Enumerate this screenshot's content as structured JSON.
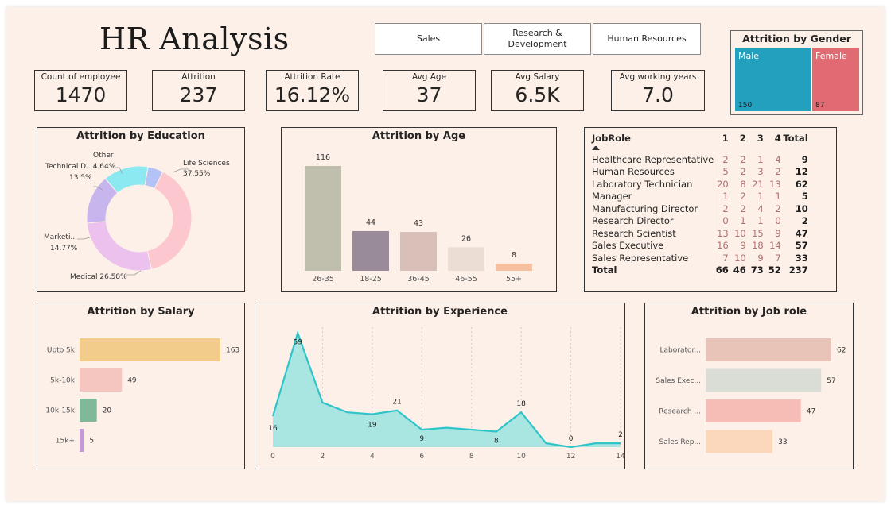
{
  "title": "HR Analysis",
  "slicer": [
    "Sales",
    "Research & Development",
    "Human Resources"
  ],
  "kpis": [
    {
      "label": "Count of employee",
      "value": "1470"
    },
    {
      "label": "Attrition",
      "value": "237"
    },
    {
      "label": "Attrition Rate",
      "value": "16.12%"
    },
    {
      "label": "Avg Age",
      "value": "37"
    },
    {
      "label": "Avg Salary",
      "value": "6.5K"
    },
    {
      "label": "Avg working years",
      "value": "7.0"
    }
  ],
  "gender": {
    "title": "Attrition by Gender",
    "male_label": "Male",
    "male_value": "150",
    "female_label": "Female",
    "female_value": "87",
    "colors": {
      "male": "#22a0bd",
      "female": "#e06b73"
    }
  },
  "chart_data": [
    {
      "type": "donut",
      "title": "Attrition by Education",
      "categories": [
        "Life Sciences",
        "Medical",
        "Marketi...",
        "Technical D...",
        "Other"
      ],
      "values": [
        37.55,
        26.58,
        14.77,
        13.5,
        4.64
      ],
      "labels": [
        "Life Sciences\n37.55%",
        "Medical 26.58%",
        "Marketi...\n14.77%",
        "Technical D...4.64%\n13.5%",
        "Other"
      ],
      "colors": [
        "#fdc7d0",
        "#ecc1ed",
        "#c6b6ed",
        "#8ce9f2",
        "#b4c3f5"
      ]
    },
    {
      "type": "bar",
      "title": "Attrition by Age",
      "categories": [
        "26-35",
        "18-25",
        "36-45",
        "46-55",
        "55+"
      ],
      "values": [
        116,
        44,
        43,
        26,
        8
      ],
      "colors": [
        "#c0bfad",
        "#9a8b9a",
        "#d8c0b8",
        "#ecddd4",
        "#f5bfa0"
      ]
    },
    {
      "type": "table",
      "title": "JobRole",
      "columns": [
        "JobRole",
        "1",
        "2",
        "3",
        "4",
        "Total"
      ],
      "rows": [
        [
          "Healthcare Representative",
          "2",
          "2",
          "1",
          "4",
          "9"
        ],
        [
          "Human Resources",
          "5",
          "2",
          "3",
          "2",
          "12"
        ],
        [
          "Laboratory Technician",
          "20",
          "8",
          "21",
          "13",
          "62"
        ],
        [
          "Manager",
          "1",
          "2",
          "1",
          "1",
          "5"
        ],
        [
          "Manufacturing Director",
          "2",
          "2",
          "4",
          "2",
          "10"
        ],
        [
          "Research Director",
          "0",
          "1",
          "1",
          "0",
          "2"
        ],
        [
          "Research Scientist",
          "13",
          "10",
          "15",
          "9",
          "47"
        ],
        [
          "Sales Executive",
          "16",
          "9",
          "18",
          "14",
          "57"
        ],
        [
          "Sales Representative",
          "7",
          "10",
          "9",
          "7",
          "33"
        ]
      ],
      "total": [
        "Total",
        "66",
        "46",
        "73",
        "52",
        "237"
      ]
    },
    {
      "type": "hbar",
      "title": "Attrition by Salary",
      "categories": [
        "Upto 5k",
        "5k-10k",
        "10k-15k",
        "15k+"
      ],
      "values": [
        163,
        49,
        20,
        5
      ],
      "colors": [
        "#f2cc8b",
        "#f5c5c0",
        "#7fb89a",
        "#c39ad1"
      ]
    },
    {
      "type": "area",
      "title": "Attrition by Experience",
      "x": [
        0,
        1,
        2,
        3,
        4,
        5,
        6,
        7,
        8,
        9,
        10,
        11,
        12,
        13,
        14
      ],
      "y": [
        16,
        59,
        23,
        18,
        17,
        19,
        9,
        10,
        9,
        8,
        18,
        2,
        0,
        2,
        2
      ],
      "labels": [
        {
          "i": 0,
          "t": "16"
        },
        {
          "i": 1,
          "t": "59"
        },
        {
          "i": 4,
          "t": "19"
        },
        {
          "i": 5,
          "t": "21"
        },
        {
          "i": 6,
          "t": "9"
        },
        {
          "i": 9,
          "t": "8"
        },
        {
          "i": 10,
          "t": "18"
        },
        {
          "i": 12,
          "t": "0"
        },
        {
          "i": 14,
          "t": "2"
        }
      ],
      "xticks": [
        "0",
        "2",
        "4",
        "6",
        "8",
        "10",
        "12",
        "14"
      ],
      "color": "#2ec4c9",
      "fill": "#a9e6e2"
    },
    {
      "type": "hbar",
      "title": "Attrition by Job role",
      "categories": [
        "Laborator...",
        "Sales Exec...",
        "Research ...",
        "Sales Rep..."
      ],
      "values": [
        62,
        57,
        47,
        33
      ],
      "colors": [
        "#e8c4b8",
        "#d9ddd5",
        "#f6bcb6",
        "#fbd7bc"
      ]
    }
  ]
}
